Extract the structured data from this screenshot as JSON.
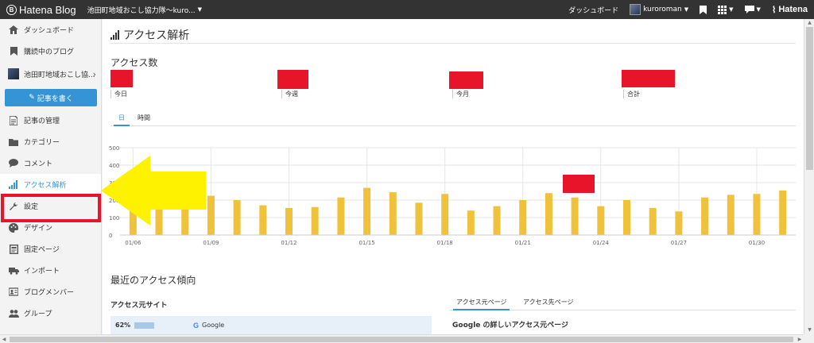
{
  "topbar": {
    "logo": "Hatena Blog",
    "blog_name": "池田町地域おこし協力隊〜kuro...",
    "dashboard": "ダッシュボード",
    "user": "kuroroman",
    "brand": "Hatena"
  },
  "sidebar": {
    "items": [
      {
        "label": "ダッシュボード",
        "icon": "home-icon"
      },
      {
        "label": "購読中のブログ",
        "icon": "bookmark-icon"
      },
      {
        "label": "池田町地域おこし協...",
        "icon": "blog-avatar"
      },
      {
        "label": "記事を書く",
        "icon": "edit-icon"
      },
      {
        "label": "記事の管理",
        "icon": "document-icon"
      },
      {
        "label": "カテゴリー",
        "icon": "folder-icon"
      },
      {
        "label": "コメント",
        "icon": "comment-icon"
      },
      {
        "label": "アクセス解析",
        "icon": "bar-chart-icon"
      },
      {
        "label": "設定",
        "icon": "wrench-icon"
      },
      {
        "label": "デザイン",
        "icon": "palette-icon"
      },
      {
        "label": "固定ページ",
        "icon": "page-icon"
      },
      {
        "label": "インポート",
        "icon": "truck-icon"
      },
      {
        "label": "ブログメンバー",
        "icon": "members-icon"
      },
      {
        "label": "グループ",
        "icon": "group-icon"
      }
    ]
  },
  "main": {
    "title": "アクセス解析",
    "access_count_heading": "アクセス数",
    "stats": [
      {
        "label": "今日"
      },
      {
        "label": "今週"
      },
      {
        "label": "今月"
      },
      {
        "label": "合計"
      }
    ],
    "tabs": [
      {
        "label": "日",
        "active": true
      },
      {
        "label": "時間",
        "active": false
      }
    ],
    "trend_heading": "最近のアクセス傾向",
    "referrer_heading": "アクセス元サイト",
    "referrer_tabs": [
      {
        "label": "アクセス元ページ",
        "active": true
      },
      {
        "label": "アクセス先ページ",
        "active": false
      }
    ],
    "google_detail_heading": "Google の詳しいアクセス元ページ",
    "referrer_rows": [
      {
        "percent": "62%",
        "share": 0.62,
        "site": "Google"
      }
    ]
  },
  "colors": {
    "bar": "#f0c23b",
    "accent": "#3594d6",
    "redact": "#e8142a",
    "arrow": "#fff200"
  },
  "chart_data": {
    "type": "bar",
    "ylim": [
      0,
      500
    ],
    "yticks": [
      "0",
      "100",
      "200",
      "300",
      "400",
      "500"
    ],
    "categories": [
      "01/06",
      "01/07",
      "01/08",
      "01/09",
      "01/10",
      "01/11",
      "01/12",
      "01/13",
      "01/14",
      "01/15",
      "01/16",
      "01/17",
      "01/18",
      "01/19",
      "01/20",
      "01/21",
      "01/22",
      "01/23",
      "01/24",
      "01/25",
      "01/26",
      "01/27",
      "01/28",
      "01/29",
      "01/30",
      "01/31"
    ],
    "xtick_labels": [
      "01/06",
      "01/09",
      "01/12",
      "01/15",
      "01/18",
      "01/21",
      "01/24",
      "01/27",
      "01/30"
    ],
    "values": [
      190,
      200,
      240,
      225,
      200,
      170,
      155,
      160,
      215,
      270,
      245,
      185,
      235,
      140,
      165,
      200,
      240,
      215,
      165,
      200,
      155,
      135,
      215,
      230,
      235,
      255
    ],
    "grid": true
  }
}
